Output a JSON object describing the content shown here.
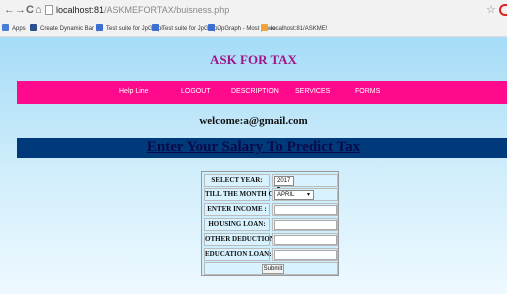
{
  "browser": {
    "back": "←",
    "forward": "→",
    "reload": "C",
    "home": "⌂",
    "url_host": "localhost:81",
    "url_path": "/ASKMEFORTAX/buisness.php",
    "star": "☆"
  },
  "bookmarks": [
    {
      "label": "Apps",
      "color": "#4a7fd6"
    },
    {
      "label": "Create Dynamic Bar (",
      "color": "#2c4f8e"
    },
    {
      "label": "Test suite for JpGrapl",
      "color": "#3b6fd0"
    },
    {
      "label": "Test suite for JpGrapl",
      "color": "#3b6fd0"
    },
    {
      "label": "JpGraph - Most powe",
      "color": "#3b6fd0"
    },
    {
      "label": "localhost:81/ASKME!",
      "color": "#f2a23a"
    }
  ],
  "site": {
    "title": "ASK FOR TAX",
    "nav": [
      "Help Line",
      "LOGOUT",
      "DESCRIPTION",
      "SERVICES",
      "FORMS"
    ],
    "welcome": "welcome:a@gmail.com",
    "banner": "Enter Your Salary To Predict Tax"
  },
  "form": {
    "select_year_label": "SELECT YEAR:",
    "select_year_value": "2017 ▾",
    "month_label": "TILL THE MONTH OF :",
    "month_value": "APRIL",
    "income_label": "ENTER INCOME :",
    "housing_label": "HOUSING LOAN:",
    "other_label": "OTHER DEDUCTION:",
    "education_label": "EDUCATION LOAN:",
    "submit": "Submit"
  },
  "colors": {
    "navbar": "#ff0a8c",
    "banner_bg": "#003a7a",
    "title": "#a0148a",
    "page_bg_top": "#a6dcf7"
  }
}
